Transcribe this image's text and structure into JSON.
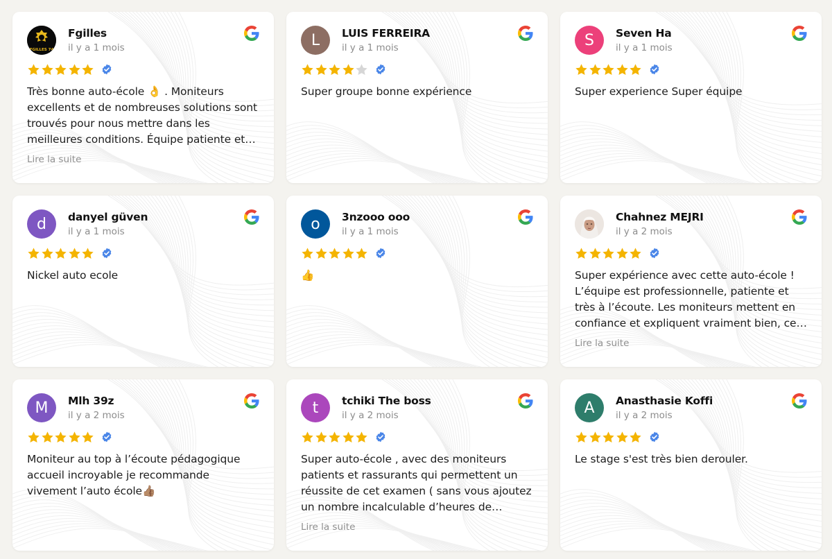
{
  "colors": {
    "background": "#f4f3ef",
    "star": "#f4b400",
    "star_empty": "#d6d6d6",
    "verified": "#4a86e8"
  },
  "reviews": [
    {
      "name": "Fgilles",
      "time": "il y a 1 mois",
      "rating": 5,
      "avatar_letter": "",
      "avatar_type": "logo",
      "avatar_logo_text": "FGILLES 74",
      "text": "Très bonne auto-école 👌 . Moniteurs excellents et de nombreuses solutions sont trouvés pour nous mettre dans les meilleures conditions. Équipe patiente et attentive.",
      "read_more": "Lire la suite"
    },
    {
      "name": "LUIS FERREIRA",
      "time": "il y a 1 mois",
      "rating": 4,
      "avatar_letter": "L",
      "avatar_color": "#8d6e63",
      "text": "Super groupe bonne expérience",
      "read_more": ""
    },
    {
      "name": "Seven Ha",
      "time": "il y a 1 mois",
      "rating": 5,
      "avatar_letter": "S",
      "avatar_color": "#ec407a",
      "text": "Super experience Super équipe",
      "read_more": ""
    },
    {
      "name": "danyel güven",
      "time": "il y a 1 mois",
      "rating": 5,
      "avatar_letter": "d",
      "avatar_color": "#7e57c2",
      "text": "Nickel auto ecole",
      "read_more": ""
    },
    {
      "name": "3nzooo ooo",
      "time": "il y a 1 mois",
      "rating": 5,
      "avatar_letter": "o",
      "avatar_color": "#01579b",
      "text": "👍",
      "read_more": ""
    },
    {
      "name": "Chahnez MEJRI",
      "time": "il y a 2 mois",
      "rating": 5,
      "avatar_letter": "",
      "avatar_type": "photo",
      "text": "Super expérience avec cette auto-école ! L’équipe est professionnelle, patiente et très à l’écoute. Les moniteurs mettent en confiance et expliquent vraiment bien, ce qui aide beaucoup.",
      "read_more": "Lire la suite"
    },
    {
      "name": "Mlh 39z",
      "time": "il y a 2 mois",
      "rating": 5,
      "avatar_letter": "M",
      "avatar_color": "#7e57c2",
      "text": "Moniteur au top à l’écoute pédagogique accueil incroyable je recommande vivement l’auto école👍🏽",
      "read_more": ""
    },
    {
      "name": "tchiki The boss",
      "time": "il y a 2 mois",
      "rating": 5,
      "avatar_letter": "t",
      "avatar_color": "#ab47bc",
      "text": "Super auto-école , avec des moniteurs patients et rassurants qui permettent un réussite de cet examen ( sans vous ajoutez un nombre incalculable d’heures de conduite ).",
      "read_more": "Lire la suite"
    },
    {
      "name": "Anasthasie Koffi",
      "time": "il y a 2 mois",
      "rating": 5,
      "avatar_letter": "A",
      "avatar_color": "#2e7d6b",
      "text": "Le stage s'est très bien derouler.",
      "read_more": ""
    }
  ]
}
